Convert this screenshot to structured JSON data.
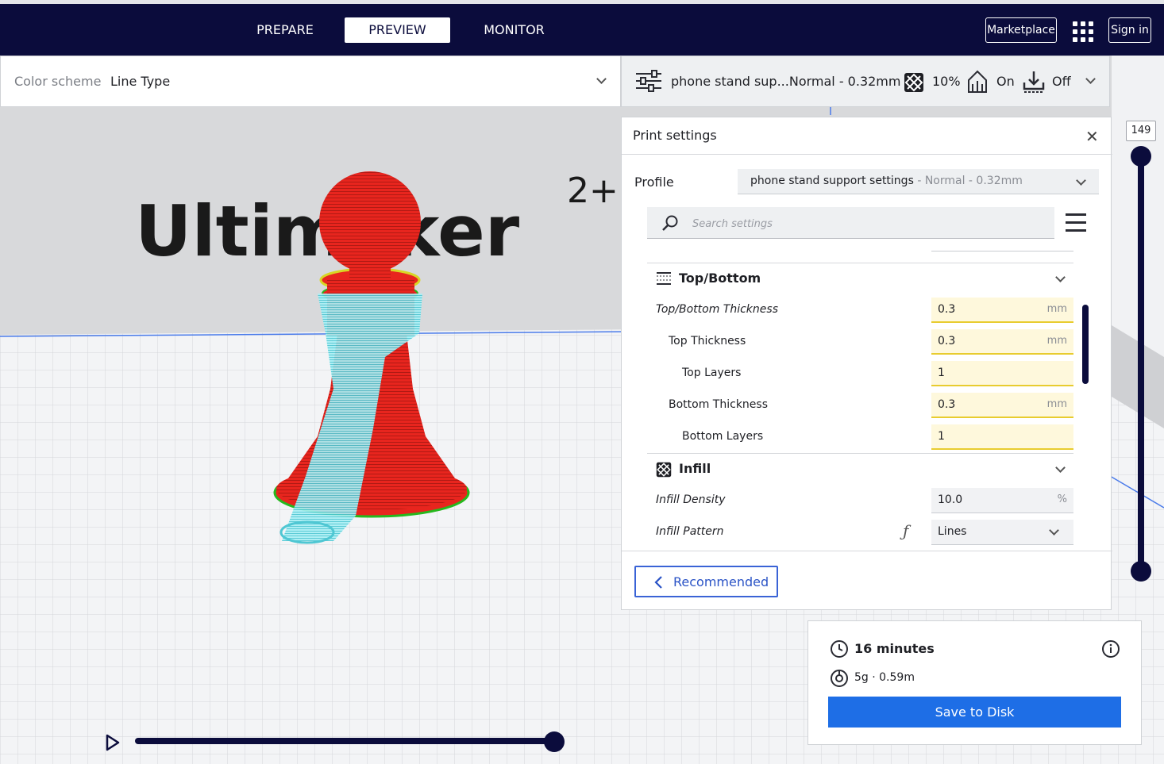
{
  "header": {
    "tabs": [
      {
        "label": "PREPARE"
      },
      {
        "label": "PREVIEW"
      },
      {
        "label": "MONITOR"
      }
    ],
    "marketplace_label": "Marketplace",
    "signin_label": "Sign in"
  },
  "color_scheme": {
    "label": "Color scheme",
    "value": "Line Type"
  },
  "print_bar": {
    "profile_summary": "phone stand sup...Normal - 0.32mm",
    "infill": "10%",
    "support": "On",
    "adhesion": "Off"
  },
  "viewport": {
    "brand_text": "Ultimaker",
    "brand_suffix": "2+"
  },
  "print_settings": {
    "title": "Print settings",
    "profile_label": "Profile",
    "profile_name": "phone stand support settings",
    "profile_sub": " - Normal - 0.32mm",
    "search_placeholder": "Search settings",
    "categories": {
      "top_bottom": "Top/Bottom",
      "infill": "Infill"
    },
    "rows": [
      {
        "label": "Top/Bottom Thickness",
        "value": "0.3",
        "unit": "mm"
      },
      {
        "label": "Top Thickness",
        "value": "0.3",
        "unit": "mm"
      },
      {
        "label": "Top Layers",
        "value": "1",
        "unit": ""
      },
      {
        "label": "Bottom Thickness",
        "value": "0.3",
        "unit": "mm"
      },
      {
        "label": "Bottom Layers",
        "value": "1",
        "unit": ""
      },
      {
        "label": "Infill Density",
        "value": "10.0",
        "unit": "%"
      },
      {
        "label": "Infill Pattern",
        "value": "Lines",
        "unit": ""
      }
    ],
    "recommended_label": "Recommended"
  },
  "summary": {
    "time": "16 minutes",
    "material": "5g · 0.59m",
    "save_label": "Save to Disk"
  },
  "layer_slider": {
    "current_layer": "149"
  },
  "colors": {
    "navy": "#0b0c3c",
    "accent_blue": "#1e6ee6",
    "model_red": "#e8251e",
    "support_cyan": "#7fe3ec",
    "field_yellow": "#fef8dc"
  }
}
